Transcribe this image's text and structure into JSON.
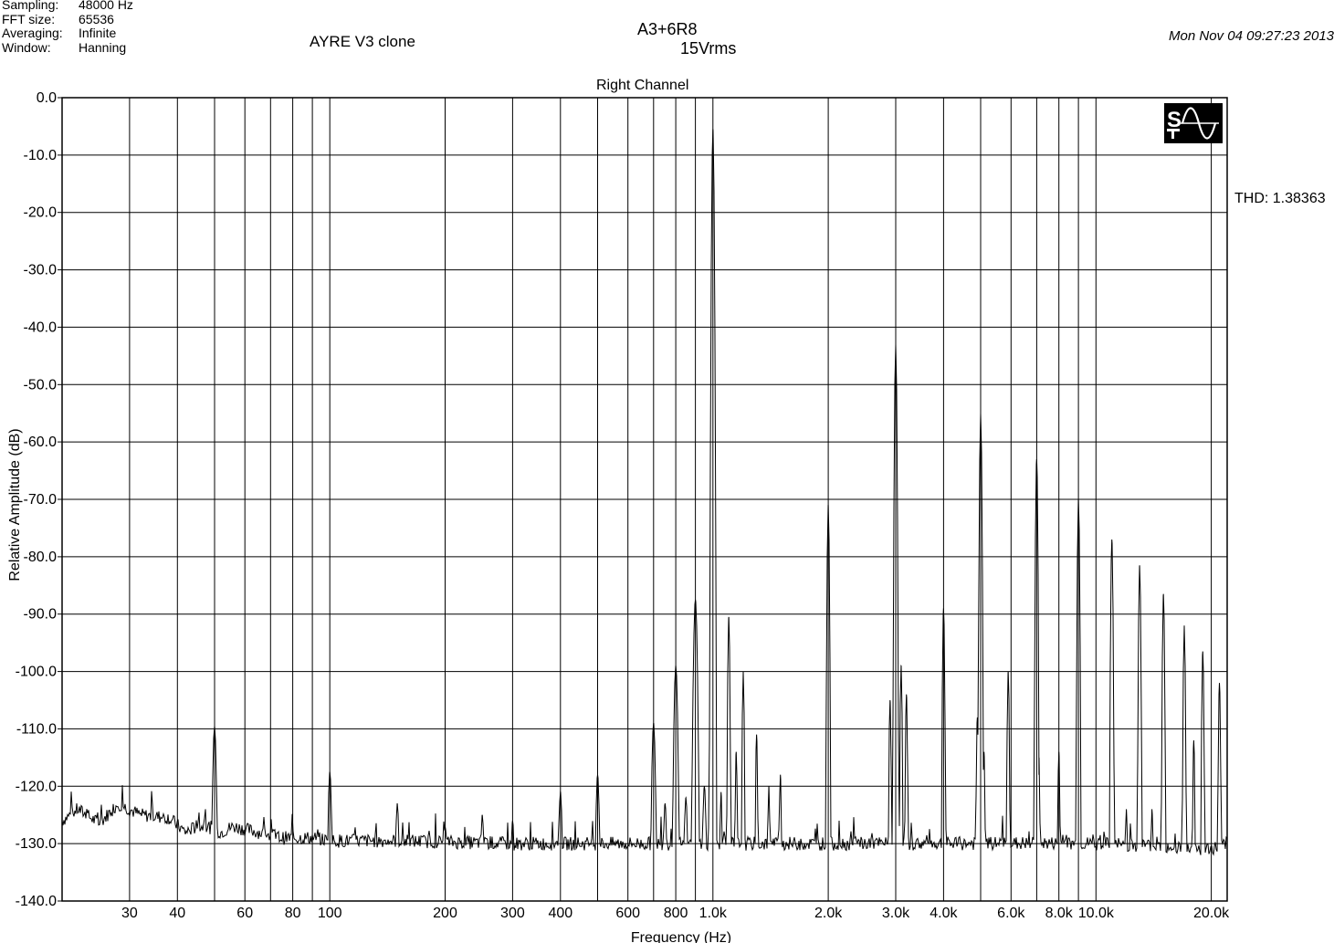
{
  "info": [
    {
      "label": "Sampling:",
      "value": "48000 Hz"
    },
    {
      "label": "FFT size:",
      "value": "65536"
    },
    {
      "label": "Averaging:",
      "value": "Infinite"
    },
    {
      "label": "Window:",
      "value": "Hanning"
    }
  ],
  "subtitle": "AYRE V3 clone",
  "title_line1": "A3+6R8",
  "title_line2": "15Vrms",
  "datestamp": "Mon Nov 04 09:27:23 2013",
  "thd_text": "THD: 1.38363",
  "logo_icon": "spectraplus-logo-icon",
  "chart_data": {
    "type": "line",
    "title": "Right Channel",
    "xlabel": "Frequency (Hz)",
    "ylabel": "Relative Amplitude (dB)",
    "xscale": "log",
    "xlim": [
      20,
      22000
    ],
    "ylim": [
      -140,
      0
    ],
    "grid": true,
    "y_ticks": [
      0,
      -10,
      -20,
      -30,
      -40,
      -50,
      -60,
      -70,
      -80,
      -90,
      -100,
      -110,
      -120,
      -130,
      -140
    ],
    "y_tick_labels": [
      "0.0",
      "-10.0",
      "-20.0",
      "-30.0",
      "-40.0",
      "-50.0",
      "-60.0",
      "-70.0",
      "-80.0",
      "-90.0",
      "-100.0",
      "-110.0",
      "-120.0",
      "-130.0",
      "-140.0"
    ],
    "x_ticks": [
      30,
      40,
      60,
      80,
      100,
      200,
      300,
      400,
      600,
      800,
      1000,
      2000,
      3000,
      4000,
      6000,
      8000,
      10000,
      20000
    ],
    "x_tick_labels": [
      "30",
      "40",
      "60",
      "80",
      "100",
      "200",
      "300",
      "400",
      "600",
      "800",
      "1.0k",
      "2.0k",
      "3.0k",
      "4.0k",
      "6.0k",
      "8.0k",
      "10.0k",
      "20.0k"
    ],
    "x_grid": [
      30,
      40,
      50,
      60,
      70,
      80,
      90,
      100,
      200,
      300,
      400,
      500,
      600,
      700,
      800,
      900,
      1000,
      2000,
      3000,
      4000,
      5000,
      6000,
      7000,
      8000,
      9000,
      10000,
      20000
    ],
    "series": [
      {
        "color": "#000000",
        "noise_floor": -130,
        "baseline_points": [
          [
            20,
            -126
          ],
          [
            22,
            -124
          ],
          [
            25,
            -126.5
          ],
          [
            28,
            -123
          ],
          [
            32,
            -125
          ],
          [
            38,
            -125.5
          ],
          [
            42,
            -128
          ],
          [
            45,
            -127
          ],
          [
            48,
            -127
          ],
          [
            52,
            -128
          ],
          [
            56,
            -127
          ],
          [
            60,
            -127.5
          ],
          [
            65,
            -128
          ],
          [
            75,
            -129
          ],
          [
            90,
            -129
          ],
          [
            100,
            -129.5
          ],
          [
            150,
            -129.5
          ],
          [
            300,
            -130
          ],
          [
            1000,
            -130
          ],
          [
            10000,
            -130
          ],
          [
            16000,
            -130.5
          ],
          [
            20000,
            -131
          ],
          [
            22000,
            -130
          ]
        ],
        "peaks": [
          [
            50,
            -109.5
          ],
          [
            100,
            -117.5
          ],
          [
            150,
            -123
          ],
          [
            200,
            -127
          ],
          [
            250,
            -125
          ],
          [
            300,
            -126
          ],
          [
            400,
            -121
          ],
          [
            500,
            -118
          ],
          [
            700,
            -109
          ],
          [
            750,
            -123
          ],
          [
            800,
            -99
          ],
          [
            850,
            -122
          ],
          [
            900,
            -87.5
          ],
          [
            950,
            -120
          ],
          [
            1000,
            -5.5
          ],
          [
            1050,
            -121
          ],
          [
            1100,
            -90.5
          ],
          [
            1150,
            -114
          ],
          [
            1200,
            -100
          ],
          [
            1300,
            -111
          ],
          [
            1400,
            -120
          ],
          [
            1500,
            -118
          ],
          [
            2000,
            -71
          ],
          [
            2900,
            -105
          ],
          [
            3000,
            -43
          ],
          [
            3100,
            -99
          ],
          [
            3200,
            -104
          ],
          [
            4000,
            -89
          ],
          [
            4900,
            -108
          ],
          [
            5000,
            -55
          ],
          [
            5100,
            -114
          ],
          [
            5900,
            -100
          ],
          [
            7000,
            -63
          ],
          [
            7100,
            -118
          ],
          [
            8000,
            -114
          ],
          [
            9000,
            -70
          ],
          [
            11000,
            -77
          ],
          [
            12000,
            -124
          ],
          [
            13000,
            -81.5
          ],
          [
            14000,
            -124
          ],
          [
            15000,
            -86.5
          ],
          [
            17000,
            -92
          ],
          [
            18000,
            -112
          ],
          [
            19000,
            -96.5
          ],
          [
            21000,
            -102
          ]
        ]
      }
    ]
  }
}
